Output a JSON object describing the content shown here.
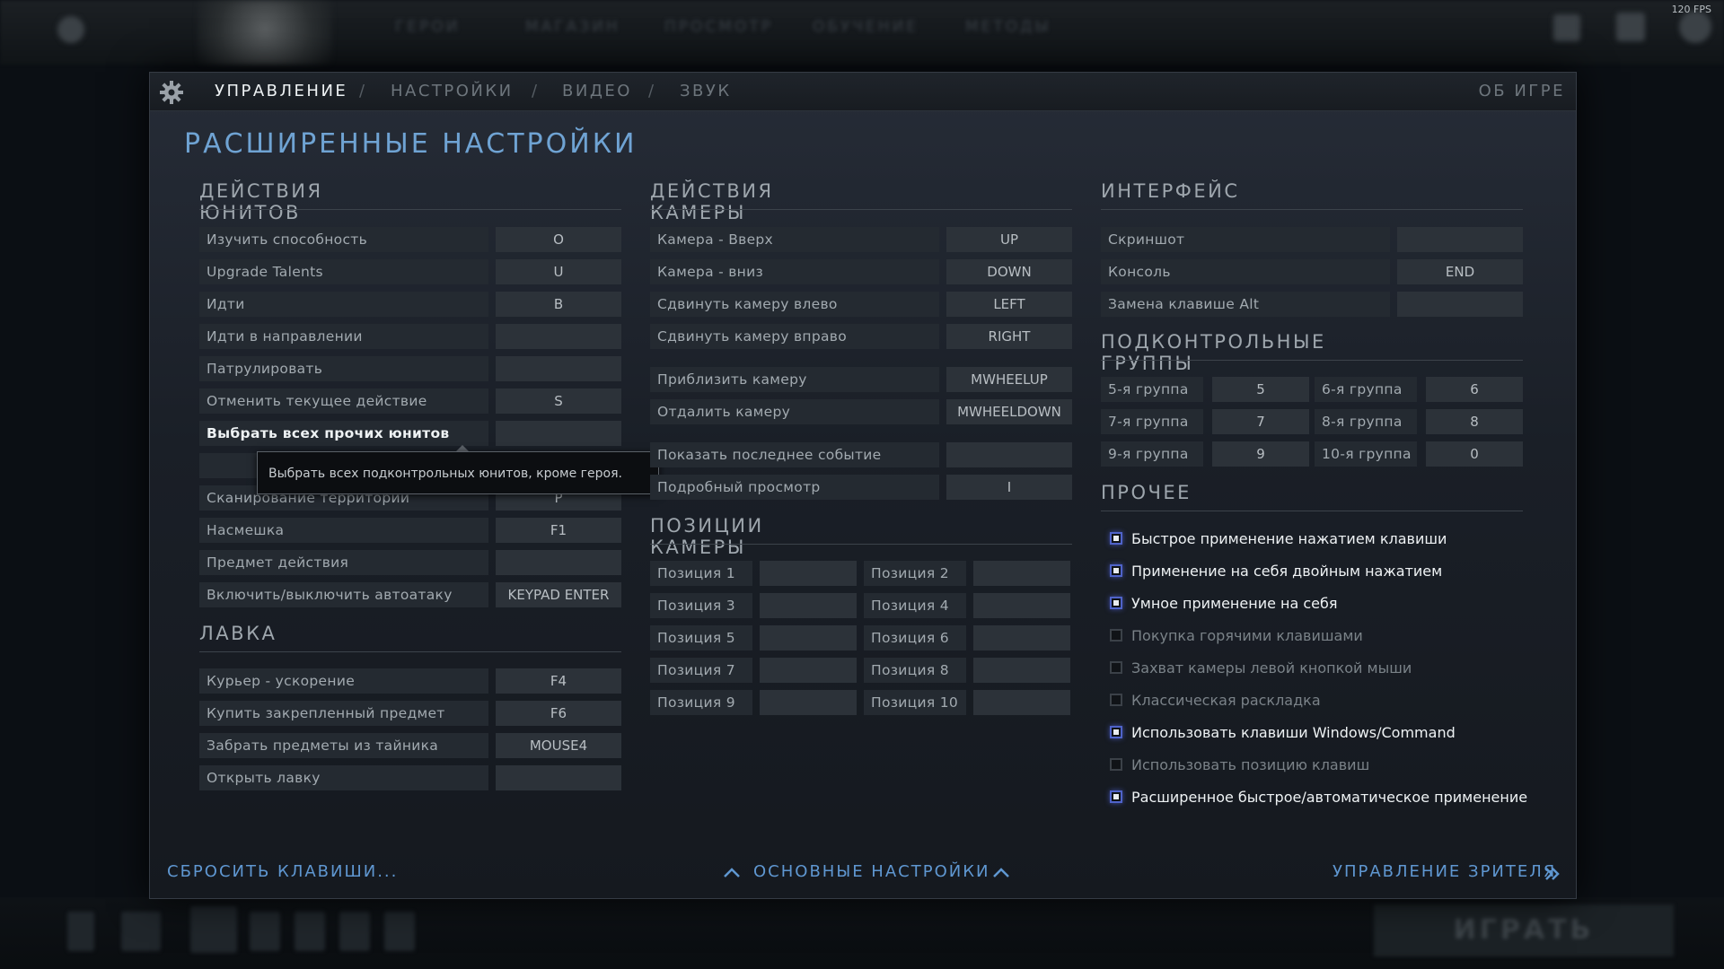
{
  "fps": "120 FPS",
  "background": {
    "nav": [
      "ГЕРОИ",
      "МАГАЗИН",
      "ПРОСМОТР",
      "ОБУЧЕНИЕ",
      "МЕТОДЫ"
    ],
    "play": "ИГРАТЬ"
  },
  "tabs": [
    {
      "label": "УПРАВЛЕНИЕ",
      "active": true
    },
    {
      "label": "НАСТРОЙКИ",
      "active": false
    },
    {
      "label": "ВИДЕО",
      "active": false
    },
    {
      "label": "ЗВУК",
      "active": false
    }
  ],
  "tab_separator": "/",
  "about": "ОБ ИГРЕ",
  "page_title": "РАСШИРЕННЫЕ НАСТРОЙКИ",
  "unit_actions": {
    "title": "ДЕЙСТВИЯ ЮНИТОВ",
    "rows": [
      {
        "label": "Изучить способность",
        "key": "O"
      },
      {
        "label": "Upgrade Talents",
        "key": "U"
      },
      {
        "label": "Идти",
        "key": "B"
      },
      {
        "label": "Идти в направлении",
        "key": ""
      },
      {
        "label": "Патрулировать",
        "key": ""
      },
      {
        "label": "Отменить текущее действие",
        "key": "S"
      },
      {
        "label": "Выбрать всех прочих юнитов",
        "key": ""
      },
      {
        "label": "",
        "key": ""
      },
      {
        "label": "Сканирование территории",
        "key": "P"
      },
      {
        "label": "Насмешка",
        "key": "F1"
      },
      {
        "label": "Предмет действия",
        "key": ""
      },
      {
        "label": "Включить/выключить автоатаку",
        "key": "KEYPAD ENTER"
      }
    ],
    "tooltip": "Выбрать всех подконтрольных юнитов, кроме героя."
  },
  "shop": {
    "title": "ЛАВКА",
    "rows": [
      {
        "label": "Курьер - ускорение",
        "key": "F4"
      },
      {
        "label": "Купить закрепленный предмет",
        "key": "F6"
      },
      {
        "label": "Забрать предметы из тайника",
        "key": "MOUSE4"
      },
      {
        "label": "Открыть лавку",
        "key": ""
      }
    ]
  },
  "camera_actions": {
    "title": "ДЕЙСТВИЯ КАМЕРЫ",
    "rows": [
      {
        "label": "Камера - Вверх",
        "key": "UP"
      },
      {
        "label": "Камера - вниз",
        "key": "DOWN"
      },
      {
        "label": "Сдвинуть камеру влево",
        "key": "LEFT"
      },
      {
        "label": "Сдвинуть камеру вправо",
        "key": "RIGHT"
      },
      {
        "label": "Приблизить камеру",
        "key": "MWHEELUP"
      },
      {
        "label": "Отдалить камеру",
        "key": "MWHEELDOWN"
      },
      {
        "label": "Показать последнее событие",
        "key": ""
      },
      {
        "label": "Подробный просмотр",
        "key": "I"
      }
    ]
  },
  "camera_positions": {
    "title": "ПОЗИЦИИ КАМЕРЫ",
    "rows": [
      {
        "label": "Позиция 1",
        "key": ""
      },
      {
        "label": "Позиция 2",
        "key": ""
      },
      {
        "label": "Позиция 3",
        "key": ""
      },
      {
        "label": "Позиция 4",
        "key": ""
      },
      {
        "label": "Позиция 5",
        "key": ""
      },
      {
        "label": "Позиция 6",
        "key": ""
      },
      {
        "label": "Позиция 7",
        "key": ""
      },
      {
        "label": "Позиция 8",
        "key": ""
      },
      {
        "label": "Позиция 9",
        "key": ""
      },
      {
        "label": "Позиция 10",
        "key": ""
      }
    ]
  },
  "interface": {
    "title": "ИНТЕРФЕЙС",
    "rows": [
      {
        "label": "Скриншот",
        "key": ""
      },
      {
        "label": "Консоль",
        "key": "END"
      },
      {
        "label": "Замена клавише Alt",
        "key": ""
      }
    ]
  },
  "control_groups": {
    "title": "ПОДКОНТРОЛЬНЫЕ ГРУППЫ",
    "rows": [
      {
        "label": "5-я группа",
        "key": "5"
      },
      {
        "label": "6-я группа",
        "key": "6"
      },
      {
        "label": "7-я группа",
        "key": "7"
      },
      {
        "label": "8-я группа",
        "key": "8"
      },
      {
        "label": "9-я группа",
        "key": "9"
      },
      {
        "label": "10-я группа",
        "key": "0"
      }
    ]
  },
  "other": {
    "title": "ПРОЧЕЕ",
    "options": [
      {
        "label": "Быстрое применение нажатием клавиши",
        "checked": true
      },
      {
        "label": "Применение на себя двойным нажатием",
        "checked": true
      },
      {
        "label": "Умное применение на себя",
        "checked": true
      },
      {
        "label": "Покупка горячими клавишами",
        "checked": false
      },
      {
        "label": "Захват камеры левой кнопкой мыши",
        "checked": false
      },
      {
        "label": "Классическая раскладка",
        "checked": false
      },
      {
        "label": "Использовать клавиши Windows/Command",
        "checked": true
      },
      {
        "label": "Использовать позицию клавиш",
        "checked": false
      },
      {
        "label": "Расширенное быстрое/автоматическое применение",
        "checked": true
      }
    ]
  },
  "footer": {
    "reset": "СБРОСИТЬ КЛАВИШИ...",
    "basic": "ОСНОВНЫЕ НАСТРОЙКИ",
    "spectator": "УПРАВЛЕНИЕ ЗРИТЕЛЯ"
  },
  "colors": {
    "accent": "#6fa3d3",
    "checkbox_on": "#4f63c9"
  }
}
